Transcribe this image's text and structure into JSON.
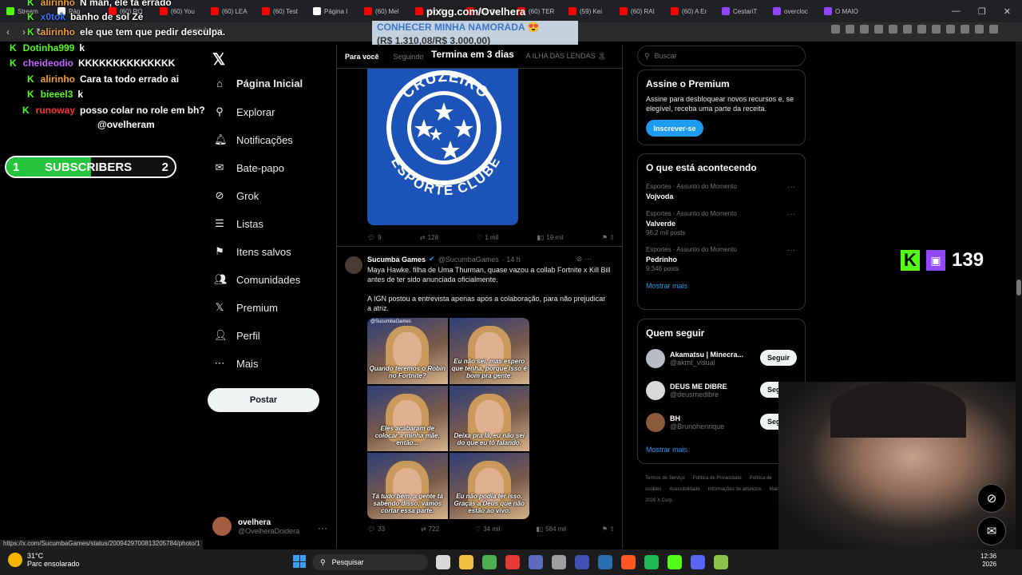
{
  "browser": {
    "tabs": [
      {
        "label": "Stream",
        "color": "#53fc18"
      },
      {
        "label": "Pág",
        "color": "#ffffff"
      },
      {
        "label": "(60) RO",
        "color": "#ff0000"
      },
      {
        "label": "(60) You",
        "color": "#ff0000"
      },
      {
        "label": "(60) LEA",
        "color": "#ff0000"
      },
      {
        "label": "(60) Test",
        "color": "#ff0000"
      },
      {
        "label": "Página I",
        "color": "#ffffff"
      },
      {
        "label": "(60) Mel",
        "color": "#ff0000"
      },
      {
        "label": "(60) Tou",
        "color": "#ff0000"
      },
      {
        "label": "(60) Qu",
        "color": "#ff0000"
      },
      {
        "label": "(60) TER",
        "color": "#ff0000"
      },
      {
        "label": "(59) Kei",
        "color": "#ff0000"
      },
      {
        "label": "(60) RAI",
        "color": "#ff0000"
      },
      {
        "label": "(60) A Er",
        "color": "#ff0000"
      },
      {
        "label": "CestariT",
        "color": "#9146ff"
      },
      {
        "label": "overcloc",
        "color": "#9146ff"
      },
      {
        "label": "O MAIO",
        "color": "#9146ff"
      }
    ],
    "url": "x.com/home",
    "window_controls": [
      "—",
      "❐",
      "✕"
    ]
  },
  "chat": [
    {
      "user": "alirinho",
      "color": "#f0a030",
      "text": "N man, ele ta errado"
    },
    {
      "user": "x0tok",
      "color": "#3a78ff",
      "text": "banho de sol Zé"
    },
    {
      "user": "alirinho",
      "color": "#f0a030",
      "text": "ele que tem que pedir desculpa."
    },
    {
      "user": "Dotinha999",
      "color": "#53fc18",
      "text": "k"
    },
    {
      "user": "cheideodio",
      "color": "#c060ff",
      "text": "KKKKKKKKKKKKKK"
    },
    {
      "user": "alirinho",
      "color": "#f0a030",
      "text": "Cara ta todo errado ai"
    },
    {
      "user": "bieeel3",
      "color": "#53fc18",
      "text": "k"
    },
    {
      "user": "runoway",
      "color": "#ff3030",
      "text": "posso colar no role em bh?"
    },
    {
      "user": "",
      "color": "#ffffff",
      "text": "@ovelheram"
    }
  ],
  "subs": {
    "left": "1",
    "label": "SUBSCRIBERS",
    "right": "2",
    "progress": 0.5
  },
  "overlay": {
    "pixgg": "pixgg.com/Ovelhera",
    "donate_title": "CONHECER MINHA NAMORADA 😍",
    "donate_amount": "(R$ 1.310,08/R$ 3.000,00)",
    "termina": "Termina em 3 dias",
    "kick_count": "139"
  },
  "x_nav": {
    "logo": "𝕏",
    "items": [
      {
        "label": "Página Inicial",
        "icon": "home-icon",
        "glyph": "⌂",
        "active": true
      },
      {
        "label": "Explorar",
        "icon": "search-icon",
        "glyph": "⚲"
      },
      {
        "label": "Notificações",
        "icon": "bell-icon",
        "glyph": "🔔︎"
      },
      {
        "label": "Bate-papo",
        "icon": "mail-icon",
        "glyph": "✉"
      },
      {
        "label": "Grok",
        "icon": "grok-icon",
        "glyph": "⊘"
      },
      {
        "label": "Listas",
        "icon": "list-icon",
        "glyph": "☰"
      },
      {
        "label": "Itens salvos",
        "icon": "bookmark-icon",
        "glyph": "⚑"
      },
      {
        "label": "Comunidades",
        "icon": "people-icon",
        "glyph": "👥︎"
      },
      {
        "label": "Premium",
        "icon": "x-icon",
        "glyph": "𝕏"
      },
      {
        "label": "Perfil",
        "icon": "user-icon",
        "glyph": "👤︎"
      },
      {
        "label": "Mais",
        "icon": "more-icon",
        "glyph": "⋯"
      }
    ],
    "post_label": "Postar",
    "account": {
      "name": "ovelhera",
      "handle": "@OvelheraDoidera"
    }
  },
  "feed": {
    "tabs": [
      "Para você",
      "Seguindo",
      "A ILHA DAS LENDAS 🏝"
    ],
    "post1": {
      "image_text_top": "CRUZEIRO",
      "image_text_bottom": "ESPORTE CLUBE",
      "replies": "9",
      "reposts": "128",
      "likes": "1 mil",
      "views": "19 mil"
    },
    "post2": {
      "name": "Sucumba Games",
      "handle": "@SucumbaGames",
      "time": "· 14 h",
      "text1": "Maya Hawke. filha de Uma Thurman, quase vazou a collab Fortnite x Kill Bill antes de ter sido anunciada oficialmente.",
      "text2": "A IGN postou a entrevista apenas após a colaboração, para não prejudicar a atriz.",
      "captions": [
        "Quando teremos o Robin no Fortnite?",
        "Eu não sei, mas espero que tenha, porque isso é bom pra gente.",
        "Eles acabaram de colocar a minha mãe, então...",
        "Deixa pra lá, eu não sei do que eu tô falando.",
        "Tá tudo bem, a gente tá sabendo disso, vamos cortar essa parte.",
        "Eu não podia ter isso. Graças a Deus que não estão ao vivo."
      ],
      "watermark": "@SucumbaGames",
      "replies": "33",
      "reposts": "722",
      "likes": "34 mil",
      "views": "584 mil"
    }
  },
  "sidebar": {
    "search_placeholder": "Buscar",
    "premium": {
      "title": "Assine o Premium",
      "text": "Assine para desbloquear novos recursos e, se elegível, receba uma parte da receita.",
      "button": "Inscrever-se"
    },
    "trends": {
      "title": "O que está acontecendo",
      "items": [
        {
          "category": "Esportes · Assunto do Momento",
          "topic": "Vojvoda",
          "count": ""
        },
        {
          "category": "Esportes · Assunto do Momento",
          "topic": "Valverde",
          "count": "96,2 mil posts"
        },
        {
          "category": "Esportes · Assunto do Momento",
          "topic": "Pedrinho",
          "count": "9.346 posts"
        }
      ],
      "more": "Mostrar mais"
    },
    "follow": {
      "title": "Quem seguir",
      "items": [
        {
          "name": "Akamatsu | Minecra...",
          "handle": "@akmt_visual",
          "button": "Seguir",
          "color": "#b8bcc4"
        },
        {
          "name": "DEUS ME DIBRE",
          "handle": "@deusmedibre",
          "button": "Seguir",
          "color": "#d9d9d9"
        },
        {
          "name": "BH",
          "handle": "@Brunohenrique",
          "button": "Seguir",
          "color": "#8a5a3a"
        }
      ],
      "more": "Mostrar mais"
    },
    "footer": [
      "Termos de Serviço",
      "Política de Privacidade",
      "Política de cookies",
      "Acessibilidade",
      "Informações de anúncios",
      "Mais ···",
      "© 2026 X Corp."
    ]
  },
  "status_url": "https://x.com/SucumbaGames/status/2009429700813205784/photo/1",
  "taskbar": {
    "weather_temp": "31°C",
    "weather_desc": "Parc ensolarado",
    "search": "Pesquisar",
    "time": "12:36",
    "date": "2026",
    "apps": [
      "#d8d8d8",
      "#f0c040",
      "#4caf50",
      "#e53935",
      "#5c6bc0",
      "#9e9e9e",
      "#3f51b5",
      "#2a6fb0",
      "#ff5722",
      "#1db954",
      "#53fc18",
      "#5865f2",
      "#8bc34a"
    ]
  },
  "floating": [
    "grok-icon",
    "mail-icon"
  ]
}
